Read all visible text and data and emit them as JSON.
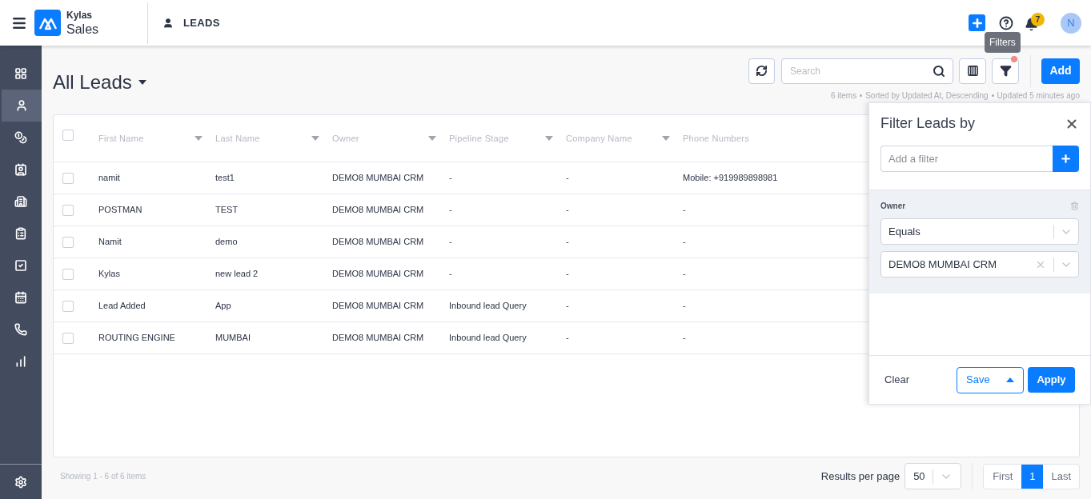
{
  "header": {
    "brand_top": "Kylas",
    "brand_bottom": "Sales",
    "module": "LEADS",
    "notification_count": "7",
    "avatar": "N"
  },
  "sidebar": {
    "items": [
      {
        "kind": "dashboard",
        "selected": false
      },
      {
        "kind": "user",
        "selected": true
      },
      {
        "kind": "money",
        "selected": false
      },
      {
        "kind": "contact",
        "selected": false
      },
      {
        "kind": "building",
        "selected": false
      },
      {
        "kind": "clipboard",
        "selected": false
      },
      {
        "kind": "task",
        "selected": false
      },
      {
        "kind": "calendar",
        "selected": false
      },
      {
        "kind": "phone",
        "selected": false
      },
      {
        "kind": "chart",
        "selected": false
      }
    ]
  },
  "page": {
    "title": "All Leads",
    "search_placeholder": "Search",
    "tooltip": "Filters",
    "filter_active": true,
    "add_button": "Add",
    "meta": [
      "6 items",
      "Sorted by Updated At, Descending",
      "Updated 5 minutes ago"
    ]
  },
  "table": {
    "select_all_checked": false,
    "columns": [
      {
        "label": "First Name",
        "sortable": true
      },
      {
        "label": "Last Name",
        "sortable": true
      },
      {
        "label": "Owner",
        "sortable": true
      },
      {
        "label": "Pipeline Stage",
        "sortable": true
      },
      {
        "label": "Company Name",
        "sortable": true
      },
      {
        "label": "Phone Numbers",
        "sortable": false
      }
    ],
    "rows": [
      {
        "checked": false,
        "cells": [
          "namit",
          "test1",
          "DEMO8 MUMBAI CRM",
          "-",
          "-",
          "Mobile: +919989898981"
        ]
      },
      {
        "checked": false,
        "cells": [
          "POSTMAN",
          "TEST",
          "DEMO8 MUMBAI CRM",
          "-",
          "-",
          "-"
        ]
      },
      {
        "checked": false,
        "cells": [
          "Namit",
          "demo",
          "DEMO8 MUMBAI CRM",
          "-",
          "-",
          "-"
        ]
      },
      {
        "checked": false,
        "cells": [
          "Kylas",
          "new lead 2",
          "DEMO8 MUMBAI CRM",
          "-",
          "-",
          "-"
        ]
      },
      {
        "checked": false,
        "cells": [
          "Lead Added",
          "App",
          "DEMO8 MUMBAI CRM",
          "Inbound lead Query",
          "-",
          "-"
        ]
      },
      {
        "checked": false,
        "cells": [
          "ROUTING ENGINE",
          "MUMBAI",
          "DEMO8 MUMBAI CRM",
          "Inbound lead Query",
          "-",
          "-"
        ]
      }
    ]
  },
  "filter_panel": {
    "title": "Filter Leads by",
    "add_placeholder": "Add a filter",
    "field": "Owner",
    "operator": "Equals",
    "value": "DEMO8 MUMBAI CRM",
    "clear": "Clear",
    "save": "Save",
    "apply": "Apply"
  },
  "footer": {
    "showing": "Showing 1 - 6 of 6 items",
    "per_page_label": "Results per page",
    "per_page": "50",
    "first": "First",
    "pages": [
      {
        "label": "1",
        "selected": true
      }
    ],
    "last": "Last"
  }
}
